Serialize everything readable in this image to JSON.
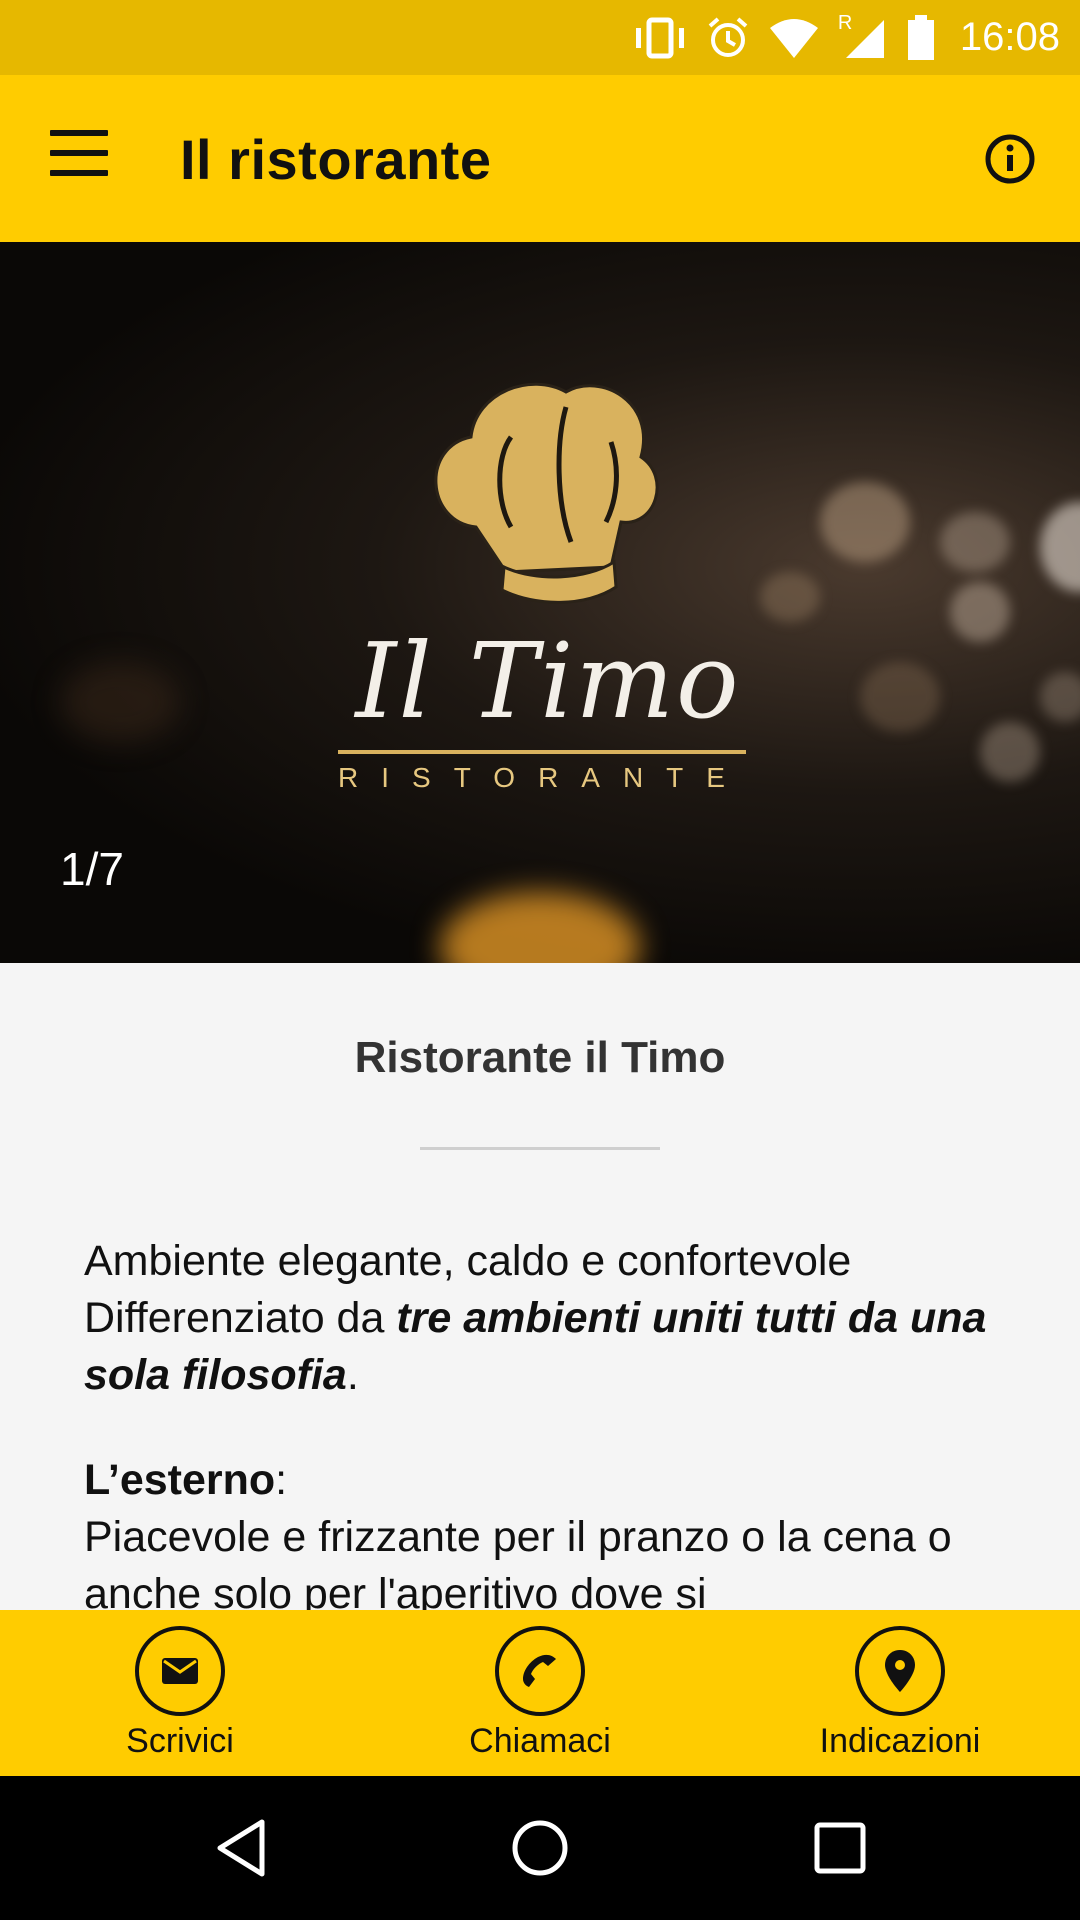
{
  "status_bar": {
    "time": "16:08",
    "network_badge": "R",
    "icons": [
      "vibrate-icon",
      "alarm-icon",
      "wifi-icon",
      "signal-icon",
      "battery-icon"
    ]
  },
  "app_bar": {
    "title": "Il ristorante",
    "menu_icon": "hamburger-menu-icon",
    "info_icon": "info-icon"
  },
  "hero": {
    "logo_text": "Il Timo",
    "logo_subtitle": "RISTORANTE",
    "counter": "1/7",
    "logo_color": "#d9b25e"
  },
  "content": {
    "title": "Ristorante il Timo",
    "para1_line1": "Ambiente elegante, caldo e confortevole",
    "para1_line2_pre": "Differenziato da ",
    "para1_bold_italic": "tre ambienti uniti tutti da una sola filosofia",
    "para1_end": ".",
    "para2_heading": "L’esterno",
    "para2_colon": ":",
    "para2_text": "Piacevole e frizzante per il  pranzo o la cena o anche solo per l'aperitivo dove si"
  },
  "actions": [
    {
      "label": "Scrivici",
      "icon": "envelope-icon"
    },
    {
      "label": "Chiamaci",
      "icon": "phone-icon"
    },
    {
      "label": "Indicazioni",
      "icon": "location-pin-icon"
    }
  ],
  "nav_bar": {
    "icons": [
      "back-icon",
      "home-icon",
      "recents-icon"
    ]
  },
  "colors": {
    "accent": "#ffcc00",
    "status_bar": "#e6b800"
  }
}
